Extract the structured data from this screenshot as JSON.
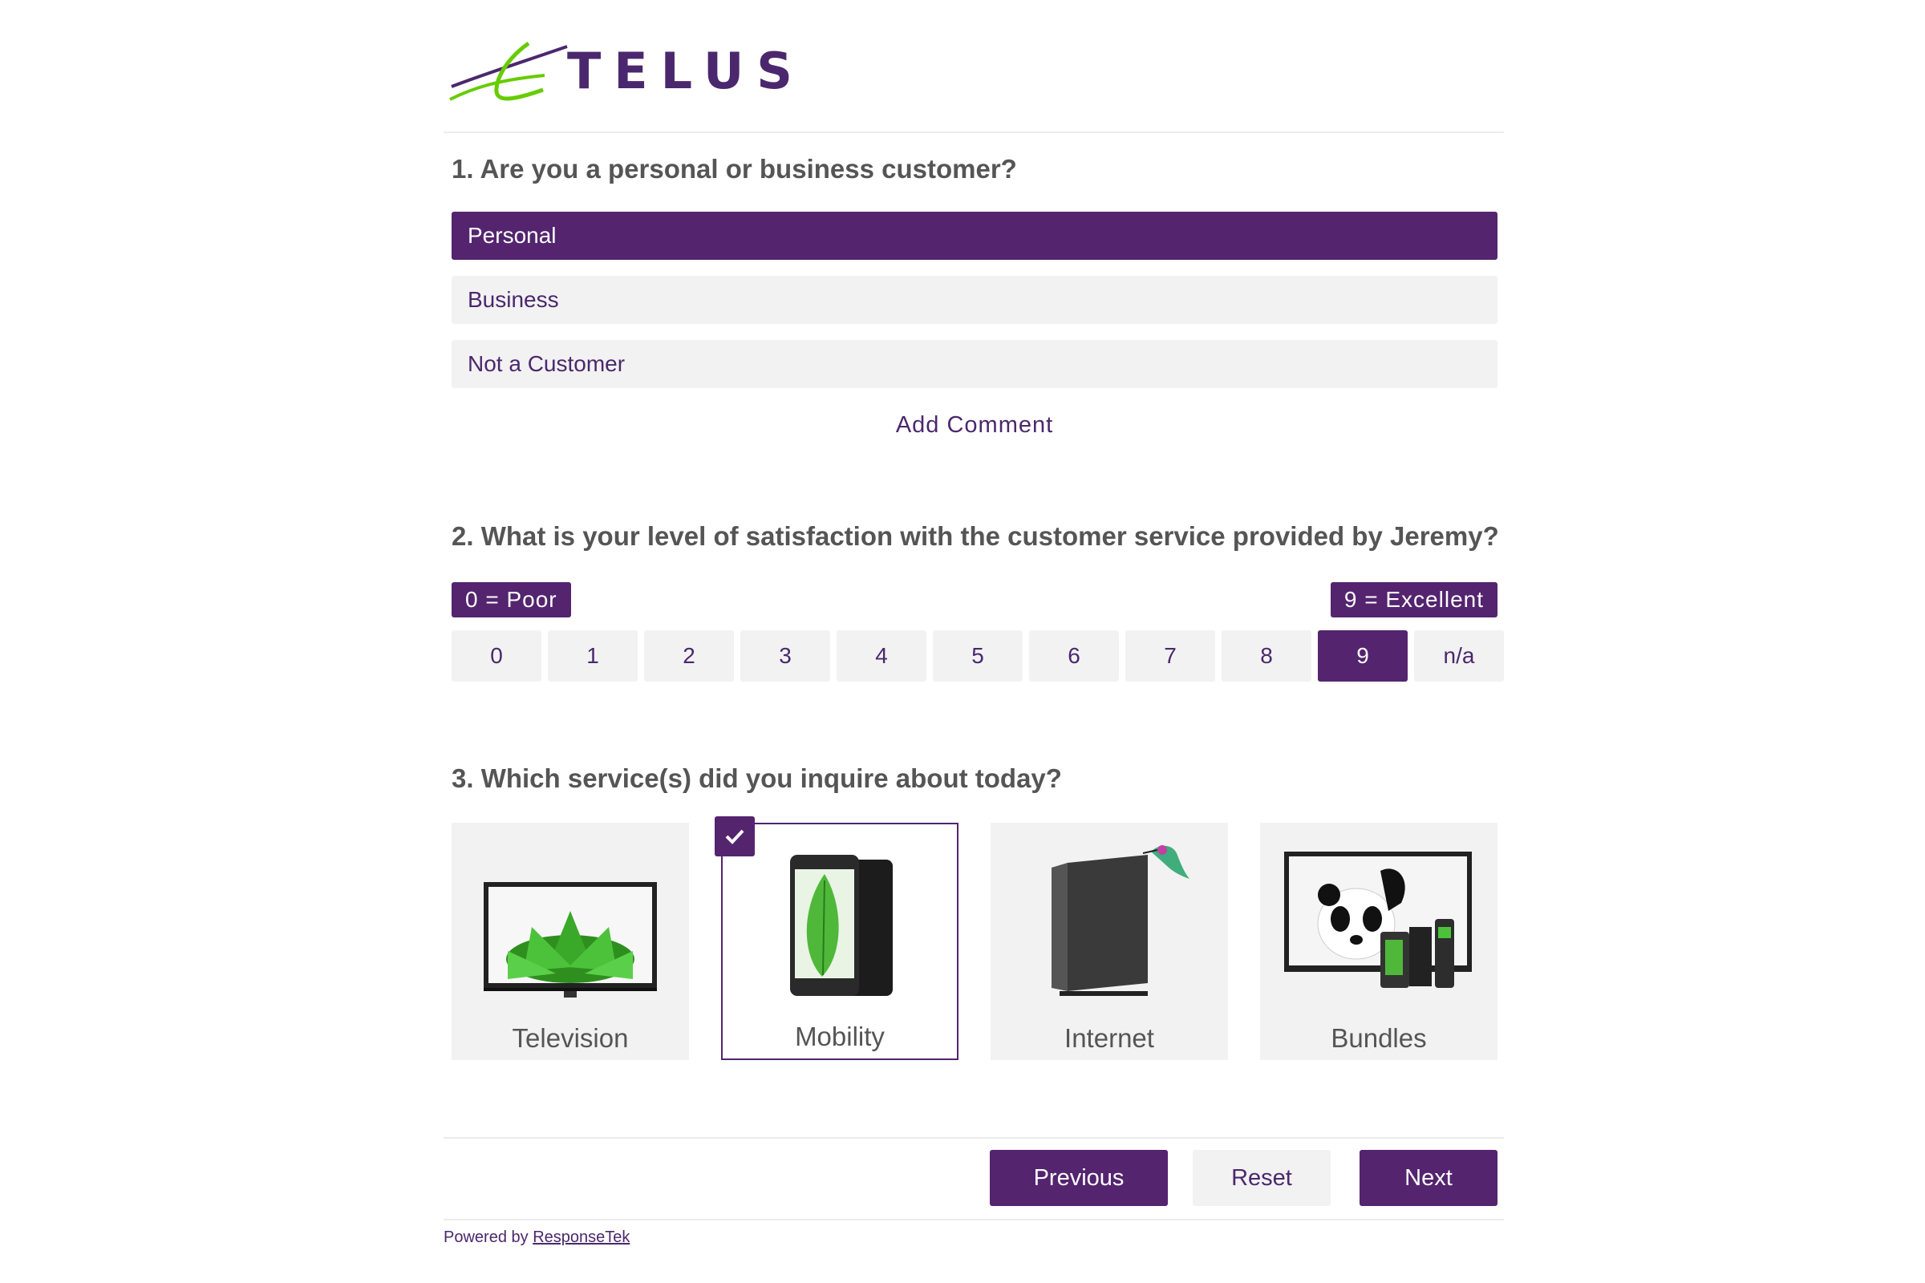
{
  "brand": {
    "name": "TELUS",
    "accent": "#54246f",
    "logo_green": "#66cc00"
  },
  "q1": {
    "title": "1. Are you a personal or business customer?",
    "options": [
      {
        "label": "Personal",
        "selected": true
      },
      {
        "label": "Business",
        "selected": false
      },
      {
        "label": "Not a Customer",
        "selected": false
      }
    ],
    "add_comment": "Add Comment"
  },
  "q2": {
    "title": "2. What is your level of satisfaction with the customer service provided by Jeremy?",
    "low_label": "0 = Poor",
    "high_label": "9 = Excellent",
    "scale": [
      "0",
      "1",
      "2",
      "3",
      "4",
      "5",
      "6",
      "7",
      "8",
      "9",
      "n/a"
    ],
    "selected": "9"
  },
  "q3": {
    "title": "3. Which service(s) did you inquire about today?",
    "services": [
      {
        "label": "Television",
        "icon": "tv-icon",
        "selected": false
      },
      {
        "label": "Mobility",
        "icon": "smartphone-icon",
        "selected": true
      },
      {
        "label": "Internet",
        "icon": "router-icon",
        "selected": false
      },
      {
        "label": "Bundles",
        "icon": "bundle-icon",
        "selected": false
      }
    ]
  },
  "nav": {
    "previous": "Previous",
    "reset": "Reset",
    "next": "Next"
  },
  "footer": {
    "powered_by": "Powered by",
    "link": "ResponseTek"
  }
}
